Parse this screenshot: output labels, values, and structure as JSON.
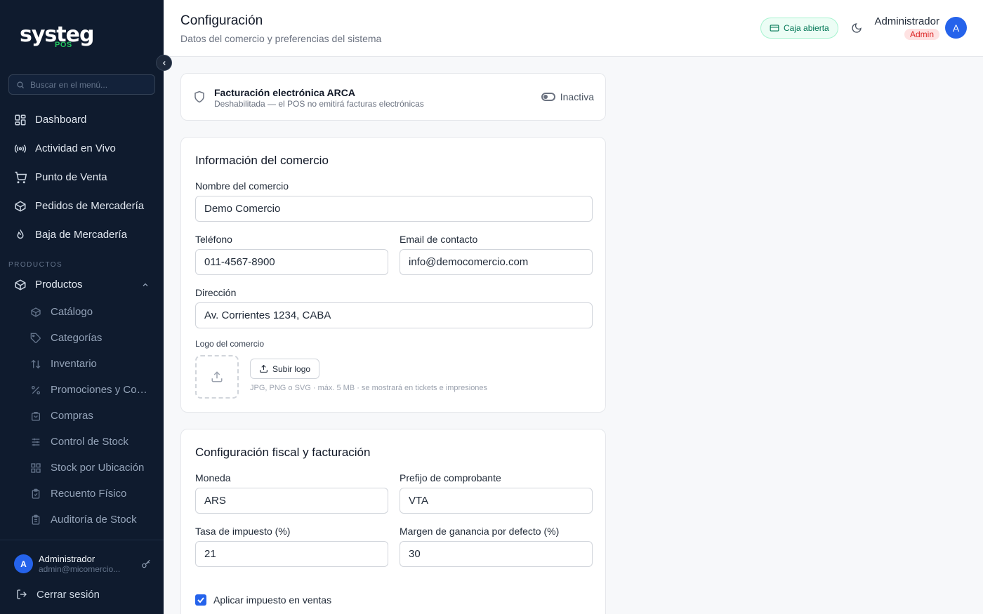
{
  "brand": {
    "name": "systeg",
    "sub": "POS"
  },
  "sidebar": {
    "search_placeholder": "Buscar en el menú...",
    "items": [
      {
        "label": "Dashboard",
        "icon": "dashboard-icon"
      },
      {
        "label": "Actividad en Vivo",
        "icon": "broadcast-icon"
      },
      {
        "label": "Punto de Venta",
        "icon": "cart-icon"
      },
      {
        "label": "Pedidos de Mercadería",
        "icon": "package-icon"
      },
      {
        "label": "Baja de Mercadería",
        "icon": "flame-icon"
      }
    ],
    "section_label": "PRODUCTOS",
    "group": {
      "label": "Productos",
      "children": [
        {
          "label": "Catálogo"
        },
        {
          "label": "Categorías"
        },
        {
          "label": "Inventario"
        },
        {
          "label": "Promociones y Combos"
        },
        {
          "label": "Compras"
        },
        {
          "label": "Control de Stock"
        },
        {
          "label": "Stock por Ubicación"
        },
        {
          "label": "Recuento Físico"
        },
        {
          "label": "Auditoría de Stock"
        }
      ]
    },
    "footer": {
      "avatar_initial": "A",
      "user_name": "Administrador",
      "user_email": "admin@micomercio...",
      "logout_label": "Cerrar sesión"
    }
  },
  "header": {
    "title": "Configuración",
    "subtitle": "Datos del comercio y preferencias del sistema",
    "cash_status": "Caja abierta",
    "user_name": "Administrador",
    "user_role": "Admin",
    "avatar_initial": "A"
  },
  "arca": {
    "title": "Facturación electrónica ARCA",
    "description": "Deshabilitada — el POS no emitirá facturas electrónicas",
    "status": "Inactiva"
  },
  "info": {
    "section_title": "Información del comercio",
    "name_label": "Nombre del comercio",
    "name_value": "Demo Comercio",
    "phone_label": "Teléfono",
    "phone_value": "011-4567-8900",
    "email_label": "Email de contacto",
    "email_value": "info@democomercio.com",
    "address_label": "Dirección",
    "address_value": "Av. Corrientes 1234, CABA",
    "logo_label": "Logo del comercio",
    "upload_label": "Subir logo",
    "upload_hint": "JPG, PNG o SVG · máx. 5 MB · se mostrará en tickets e impresiones"
  },
  "fiscal": {
    "section_title": "Configuración fiscal y facturación",
    "currency_label": "Moneda",
    "currency_value": "ARS",
    "prefix_label": "Prefijo de comprobante",
    "prefix_value": "VTA",
    "tax_label": "Tasa de impuesto (%)",
    "tax_value": "21",
    "margin_label": "Margen de ganancia por defecto (%)",
    "margin_value": "30",
    "apply_tax_label": "Aplicar impuesto en ventas",
    "apply_tax_checked": true
  },
  "colors": {
    "sidebar_bg": "#0f1b2e",
    "accent": "#2563eb",
    "brand_green": "#22c55e",
    "role_red": "#dc2626"
  }
}
